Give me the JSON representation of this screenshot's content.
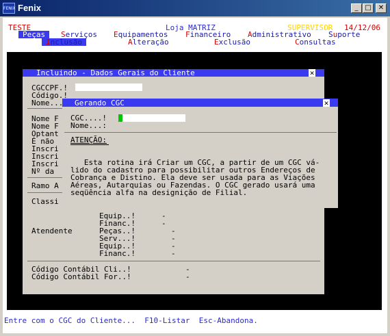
{
  "window": {
    "title": "Fenix",
    "icon_text": "FENIX",
    "min": "_",
    "max": "□",
    "close": "✕"
  },
  "header": {
    "env": "TESTE",
    "store": "Loja MATRIZ",
    "user": "SUPERVISOR",
    "date": "14/12/06"
  },
  "menu": [
    {
      "hot": "P",
      "rest": "eças"
    },
    {
      "hot": "S",
      "rest": "erviços"
    },
    {
      "hot": "E",
      "rest": "quipamentos"
    },
    {
      "hot": "F",
      "rest": "inanceiro"
    },
    {
      "hot": "A",
      "rest": "dministrativo"
    },
    {
      "pre": "S",
      "hot": "u",
      "rest": "porte"
    }
  ],
  "submenu": [
    {
      "hot": "I",
      "rest": "nclusão"
    },
    {
      "hot": "A",
      "rest": "lteração"
    },
    {
      "hot": "E",
      "rest": "xclusão"
    },
    {
      "hot": "C",
      "rest": "onsultas"
    }
  ],
  "dialog1": {
    "title": "Incluindo - Dados Gerais do Cliente",
    "close": "✕",
    "labels": {
      "cgccpf": "CGCCPF.!",
      "codigo": "Código.!",
      "nome": "Nome...",
      "nome_f1": "Nome F",
      "nome_f2": "Nome F",
      "optant": "Optant",
      "e_nao": "É não",
      "inscri1": "Inscri",
      "inscri2": "Inscri",
      "inscri3": "Inscri",
      "no_da": "Nº da",
      "ramo": "Ramo A",
      "classi": "Classi",
      "equip1": "Equip..!",
      "financ1": "Financ.!",
      "atendente": "Atendente",
      "pecas": "Peças..!",
      "serv": "Serv...!",
      "equip2": "Equip..!",
      "financ2": "Financ.!",
      "cont_cli": "Código Contábil Cli..!",
      "cont_for": "Código Contábil For..!",
      "dash": "-"
    }
  },
  "dialog2": {
    "title": "Gerando CGC",
    "close": "✕",
    "cgc_label": "CGC....!",
    "nome_label": "Nome...:",
    "attention": "ATENÇÃO:",
    "message": [
      "   Esta rotina irá Criar um CGC, a partir de um CGC vá-",
      "lido do cadastro para possibilitar outros Endereços de",
      "Cobrança e Distino. Ela deve ser usada para as Viações",
      "Aéreas, Autarquias ou Fazendas. O CGC gerado usará uma",
      "seqüência alfa na designição de Filial."
    ]
  },
  "status": "Entre com o CGC do Cliente...  F10-Listar  Esc-Abandona."
}
